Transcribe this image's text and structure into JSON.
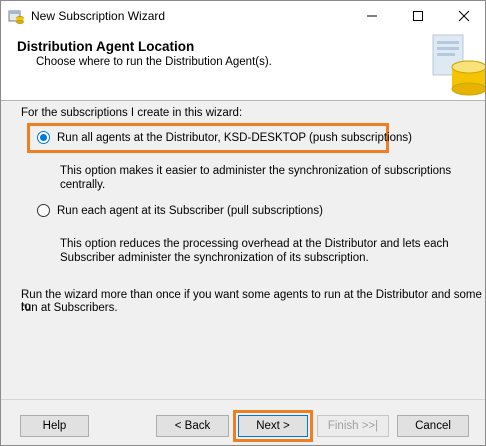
{
  "window": {
    "title": "New Subscription Wizard",
    "icon": "wizard-app-icon",
    "controls": [
      "minimize-icon",
      "maximize-icon",
      "close-icon"
    ]
  },
  "header": {
    "title": "Distribution Agent Location",
    "subtitle": "Choose where to run the Distribution Agent(s)."
  },
  "body": {
    "intro": "For the subscriptions I create in this wizard:",
    "options": [
      {
        "label": "Run all agents at the Distributor, KSD-DESKTOP (push subscriptions)",
        "checked": true,
        "description": [
          "This option makes it easier to administer the synchronization of subscriptions centrally."
        ]
      },
      {
        "label": "Run each agent at its Subscriber (pull subscriptions)",
        "checked": false,
        "description": [
          "This option reduces the processing overhead at the Distributor and lets each",
          "Subscriber administer the synchronization of its subscription."
        ]
      }
    ],
    "note": [
      "Run the wizard more than once if you want some agents to run at the Distributor and some to",
      "run at Subscribers."
    ]
  },
  "footer": {
    "help": "Help",
    "back": "< Back",
    "next": "Next >",
    "finish": "Finish >>|",
    "cancel": "Cancel"
  },
  "colors": {
    "highlight": "#f07f23",
    "accent": "#0078d7"
  }
}
